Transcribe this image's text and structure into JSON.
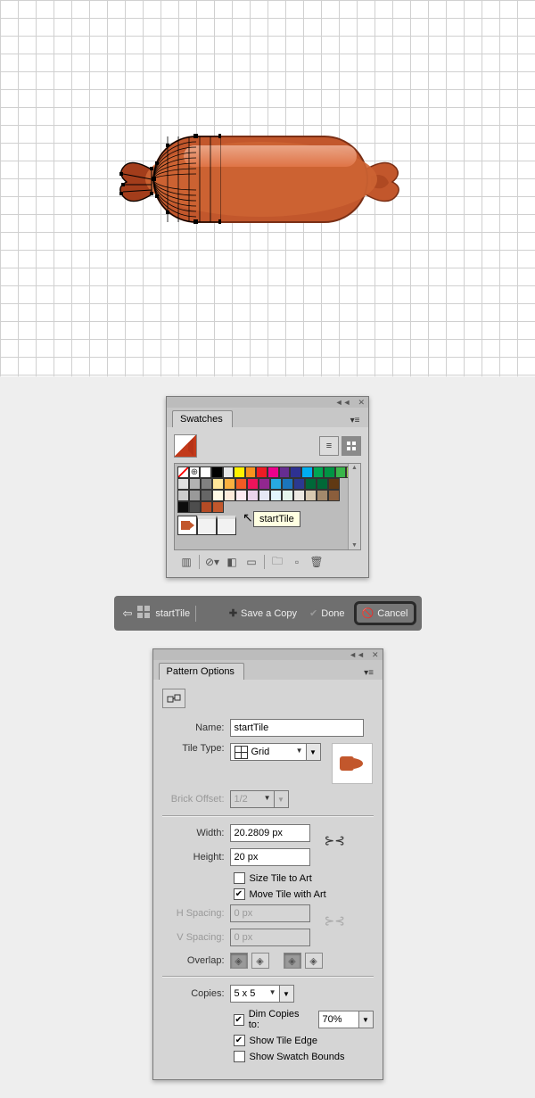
{
  "swatches": {
    "tab_label": "Swatches",
    "tooltip": "startTile"
  },
  "editbar": {
    "back_icon": "←",
    "name": "startTile",
    "save": "Save a Copy",
    "done": "Done",
    "cancel": "Cancel"
  },
  "pattern": {
    "tab_label": "Pattern Options",
    "name_label": "Name:",
    "name_value": "startTile",
    "tiletype_label": "Tile Type:",
    "tiletype_value": "Grid",
    "brickoffset_label": "Brick Offset:",
    "brickoffset_value": "1/2",
    "width_label": "Width:",
    "width_value": "20.2809 px",
    "height_label": "Height:",
    "height_value": "20 px",
    "size_to_art": "Size Tile to Art",
    "move_with_art": "Move Tile with Art",
    "hspacing_label": "H Spacing:",
    "hspacing_value": "0 px",
    "vspacing_label": "V Spacing:",
    "vspacing_value": "0 px",
    "overlap_label": "Overlap:",
    "copies_label": "Copies:",
    "copies_value": "5 x 5",
    "dim_copies": "Dim Copies to:",
    "dim_value": "70%",
    "show_tile_edge": "Show Tile Edge",
    "show_swatch_bounds": "Show Swatch Bounds"
  },
  "swatch_colors": {
    "row1": [
      "#ffffff",
      "#000000",
      "#e7e8e9",
      "#fff100",
      "#f6921e",
      "#ed1c24",
      "#ec008c",
      "#662d91",
      "#2e3192",
      "#00aeef",
      "#00a651",
      "#009444",
      "#39b54a",
      "#8cc63f"
    ],
    "row2": [
      "#e0e0e0",
      "#b2b2b2",
      "#808080",
      "#ffe699",
      "#fbb040",
      "#f15a24",
      "#ed145b",
      "#92278f",
      "#27aae1",
      "#1b75bc",
      "#2b3990",
      "#006838",
      "#006837",
      "#603913"
    ],
    "row3": [
      "#cccccc",
      "#999999",
      "#666666",
      "#fff9e5",
      "#fdeada",
      "#fdebf2",
      "#ebd4ec",
      "#e6e7f4",
      "#e2f4fd",
      "#e6f5ec",
      "#ece9e2",
      "#d7c9b1",
      "#a3896c",
      "#8b5e3c"
    ],
    "row4": [
      "#0d0d0d",
      "#4d4d4d",
      "#b44b25",
      "#c2572c"
    ]
  }
}
